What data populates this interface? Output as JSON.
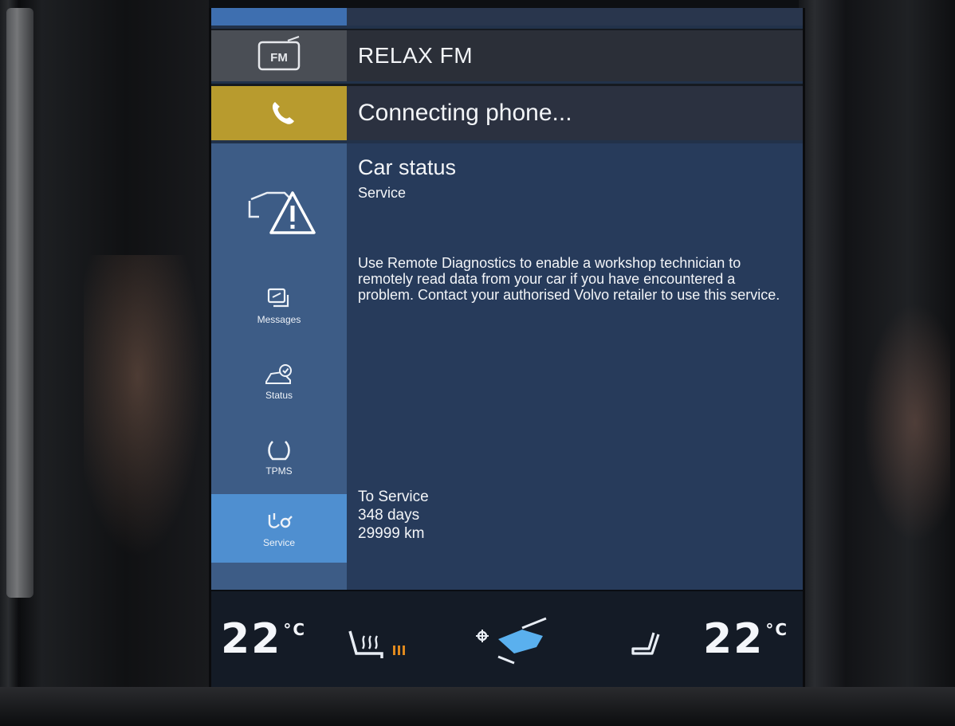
{
  "radio": {
    "station": "RELAX FM",
    "icon_label": "FM"
  },
  "phone": {
    "status": "Connecting phone..."
  },
  "sidebar": {
    "items": [
      {
        "label": "Messages"
      },
      {
        "label": "Status"
      },
      {
        "label": "TPMS"
      },
      {
        "label": "Service",
        "active": true
      }
    ]
  },
  "content": {
    "title": "Car status",
    "subtitle": "Service",
    "body": "Use Remote Diagnostics to enable a workshop technician to remotely read data from your car if you have encountered a problem. Contact your authorised Volvo retailer to use this service.",
    "service_label": "To Service",
    "service_days": "348 days",
    "service_km": "29999 km"
  },
  "climate": {
    "left_temp": "22",
    "left_unit": "°C",
    "right_temp": "22",
    "right_unit": "°C",
    "seat_heat_level": 3,
    "accent_color": "#e08a1e"
  },
  "colors": {
    "phone_accent": "#b89b2e",
    "sidebar_active": "#4f8fd0",
    "panel": "#273b5b"
  }
}
